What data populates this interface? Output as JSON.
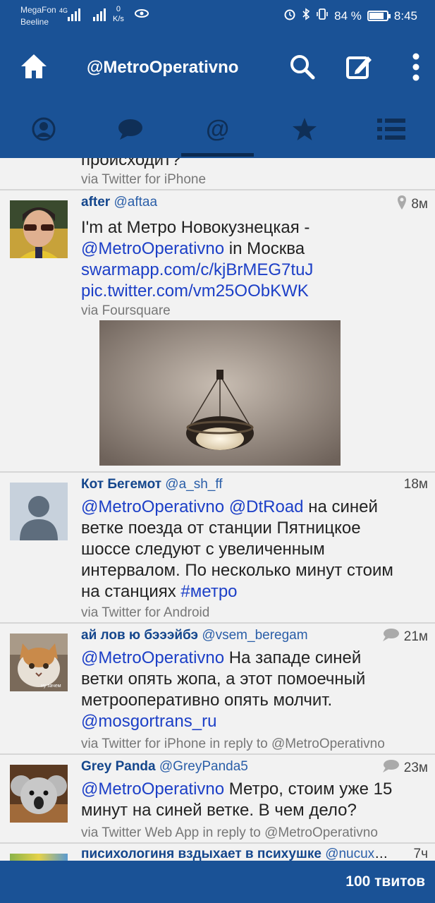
{
  "status_bar": {
    "carrier1": "MegaFon",
    "carrier2": "Beeline",
    "net_type": "4G",
    "speed_value": "0",
    "speed_unit": "K/s",
    "battery_percent": "84 %",
    "battery_level": 0.84,
    "time": "8:45"
  },
  "app_bar": {
    "title": "@MetroOperativno",
    "icons": [
      "home-icon",
      "search-icon",
      "compose-icon",
      "more-vertical-icon"
    ]
  },
  "tabs": [
    {
      "icon": "profile-icon",
      "active": false
    },
    {
      "icon": "chat-bubble-icon",
      "active": false
    },
    {
      "icon": "at-icon",
      "label": "@",
      "active": true
    },
    {
      "icon": "star-icon",
      "active": false
    },
    {
      "icon": "list-icon",
      "active": false
    }
  ],
  "partial_top": {
    "text": "происходит?",
    "via": "via Twitter for iPhone"
  },
  "tweets": [
    {
      "name": "after",
      "handle": "@aftaa",
      "time": "8м",
      "line1": "I'm at Метро Новокузнецкая -",
      "mention": "@MetroOperativno",
      "line2_rest": " in Москва",
      "url1": "swarmapp.com/c/kjBrMEG7tuJ",
      "url2": "pic.twitter.com/vm25OObKWK",
      "via": "via Foursquare",
      "has_location": true
    },
    {
      "name": "Кот Бегемот",
      "handle": "@a_sh_ff",
      "time": "18м",
      "mention1": "@MetroOperativno",
      "mention2": "@DtRoad",
      "text1": " на синей",
      "text2": "ветке поезда от станции Пятницкое",
      "text3": "шоссе следуют с увеличенным",
      "text4": "интервалом. По несколько минут стоим",
      "text5": "на станциях ",
      "hashtag": "#метро",
      "via": "via Twitter for Android"
    },
    {
      "name": "ай лов ю бэээйбэ",
      "handle": "@vsem_beregam",
      "time": "21м",
      "mention": "@MetroOperativno",
      "text1": " На западе синей",
      "text2": "ветки опять жопа, а этот помоечный",
      "text3": "метрооперативно опять молчит.",
      "mention2": "@mosgortrans_ru",
      "via": "via Twitter for iPhone in reply to @MetroOperativno",
      "avatar_caption": "ну зачем"
    },
    {
      "name": "Grey Panda",
      "handle": "@GreyPanda5",
      "time": "23м",
      "mention": "@MetroOperativno",
      "text1": " Метро, стоим уже 15",
      "text2": "минут на синей ветке. В чем дело?",
      "via": "via Twitter Web App in reply to @MetroOperativno"
    },
    {
      "name": "писихологиня вздыхает в психушке",
      "handle": "@nucuxol...",
      "time": "7ч"
    }
  ],
  "footer": {
    "count_label": "100 твитов"
  },
  "colors": {
    "bar_blue": "#1a5296",
    "link_blue": "#1c3fc7",
    "name_blue": "#14468c"
  }
}
